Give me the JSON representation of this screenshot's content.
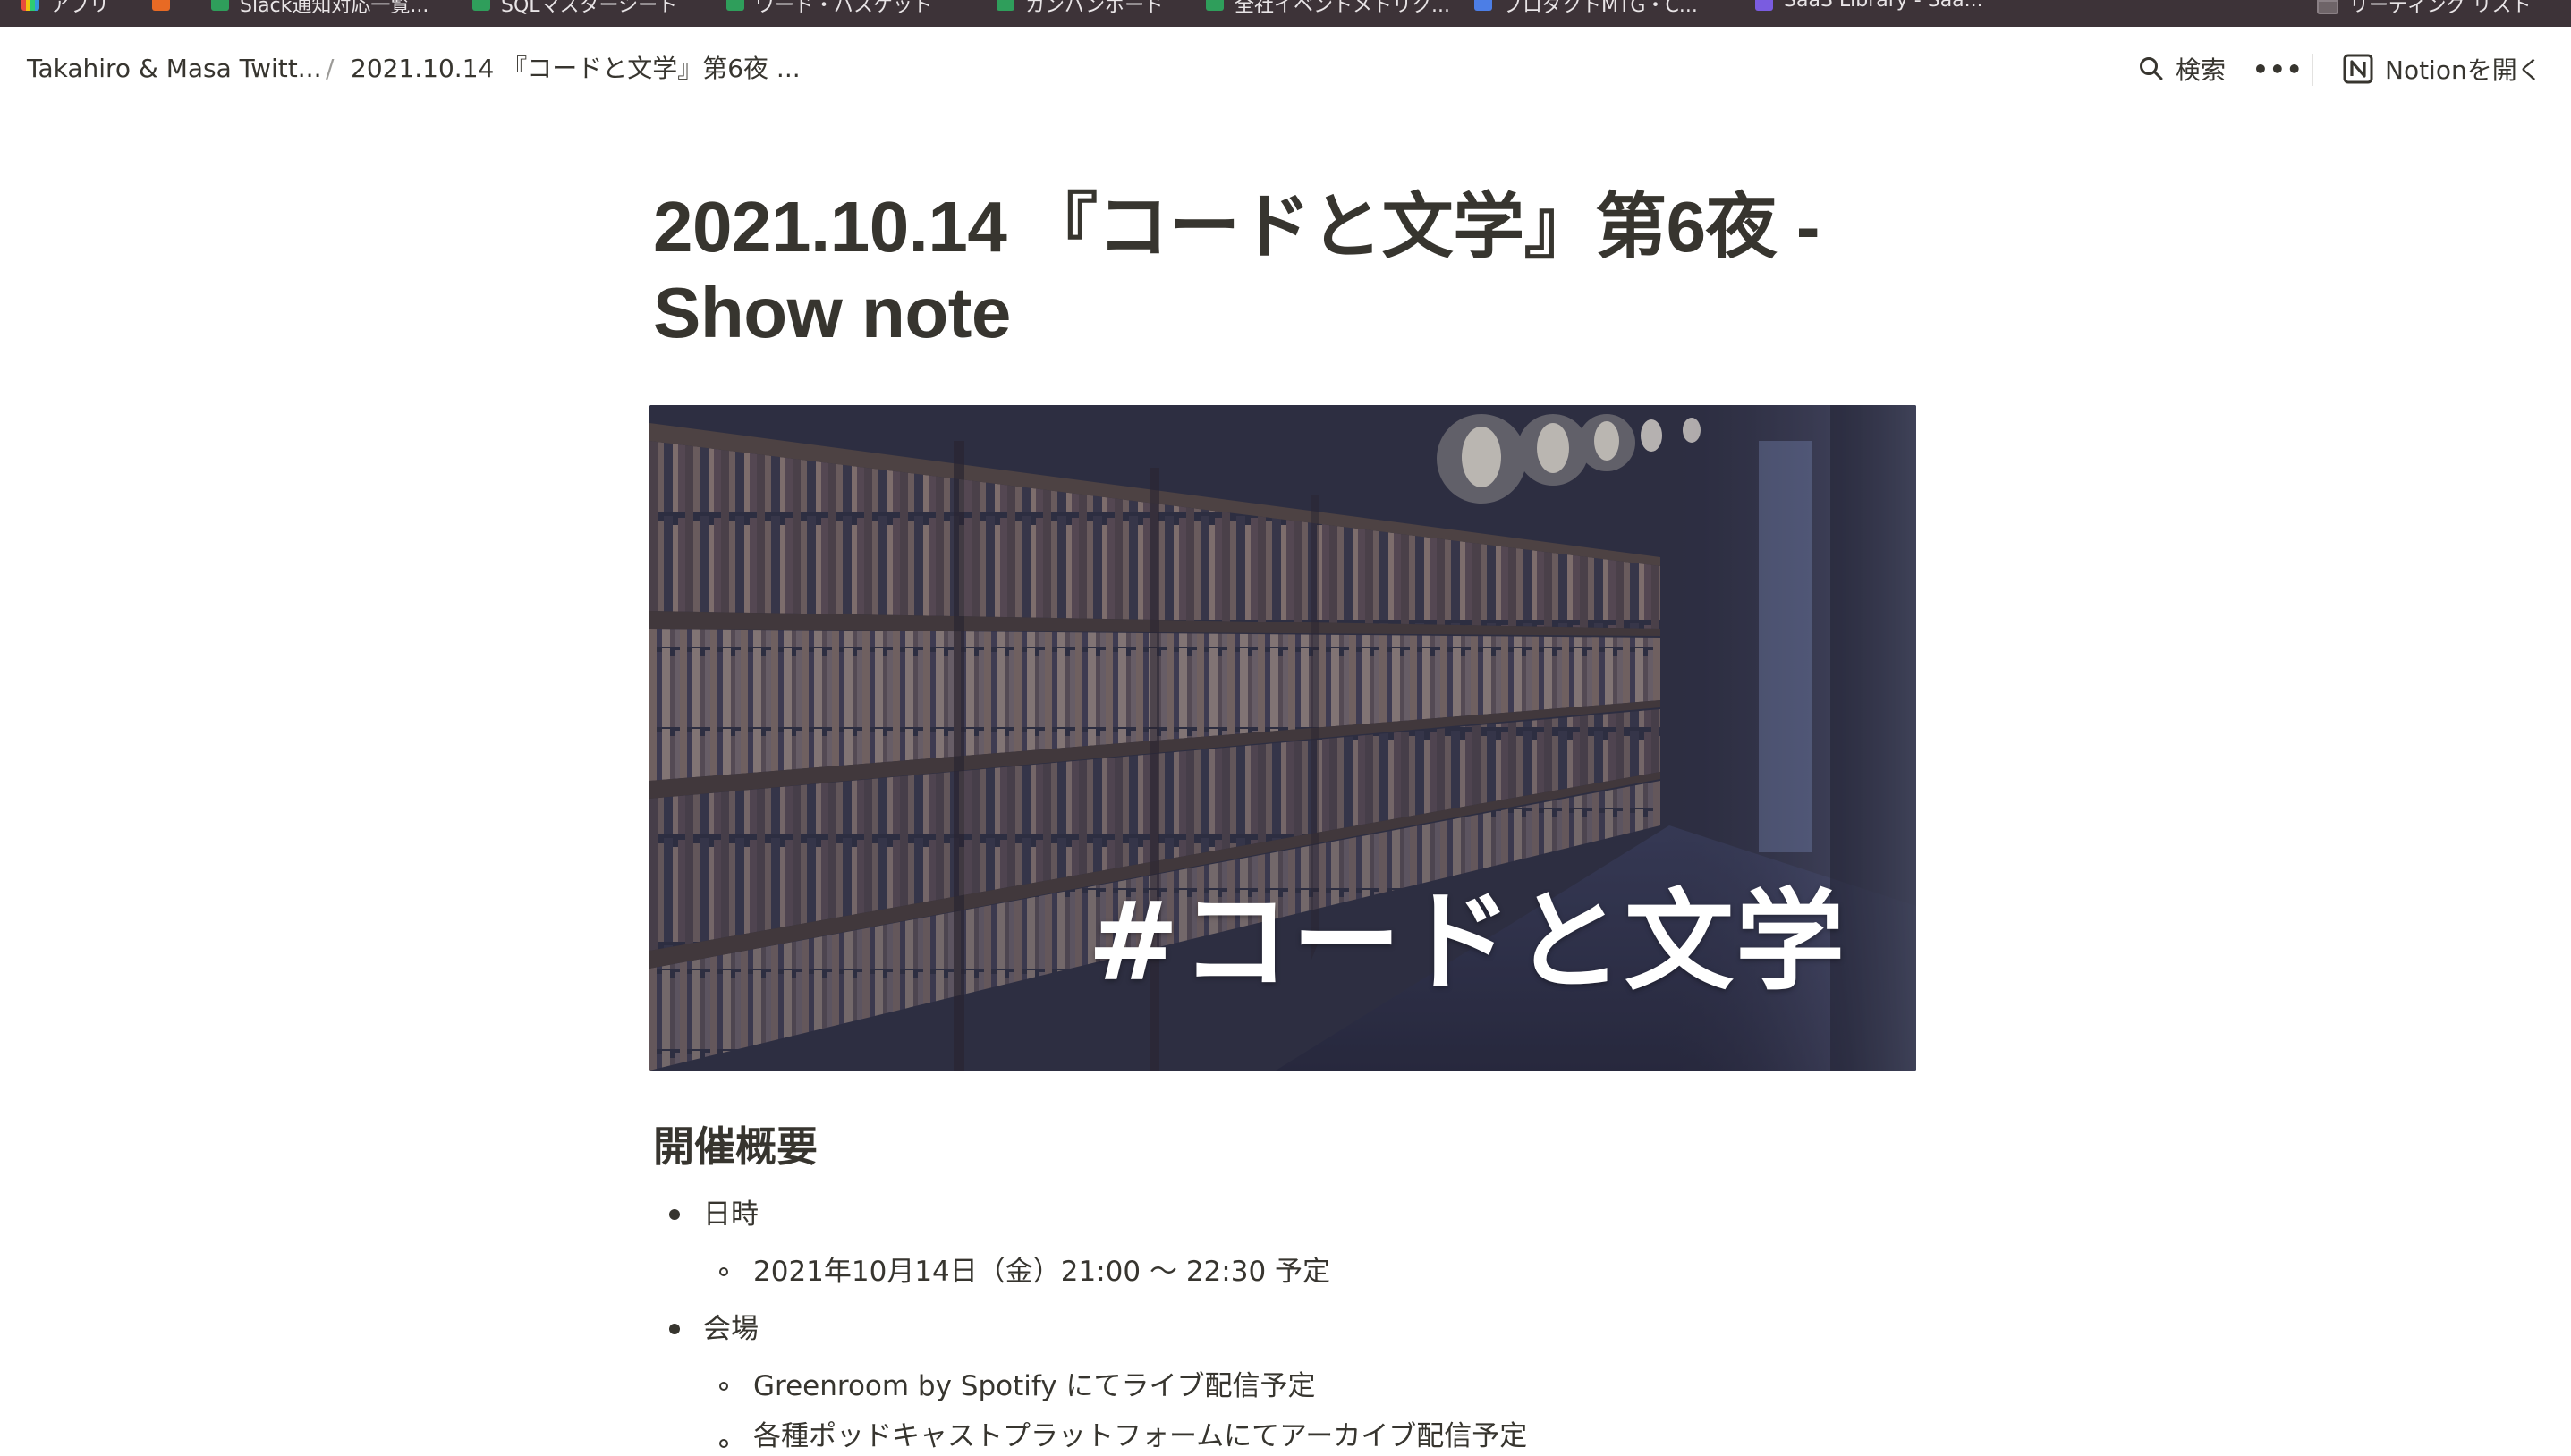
{
  "bookmarks": [
    {
      "label": "アプリ",
      "icon": "apps-grid-icon"
    },
    {
      "label": "",
      "icon": "orange-app-icon"
    },
    {
      "label": "Slack通知対応一覧...",
      "icon": "sheets-icon"
    },
    {
      "label": "SQLマスターシート",
      "icon": "sheets-icon"
    },
    {
      "label": "ワード・バスケット",
      "icon": "sheets-icon"
    },
    {
      "label": "カンバンボード",
      "icon": "sheets-icon"
    },
    {
      "label": "全社イベントメトリク...",
      "icon": "sheets-icon"
    },
    {
      "label": "プロダクトMTG・C...",
      "icon": "docs-icon"
    },
    {
      "label": "SaaS Library - Saa...",
      "icon": "saas-icon"
    },
    {
      "label": "リーディング リスト",
      "icon": "reading-list-icon"
    }
  ],
  "breadcrumb": {
    "parent": "Takahiro & Masa Twitt...",
    "separator": "/",
    "current": "2021.10.14 『コードと文学』第6夜 ..."
  },
  "actions": {
    "search_label": "検索",
    "more_label": "•••",
    "open_notion_label": "Notionを開く"
  },
  "page": {
    "title_line1": "2021.10.14 『コードと文学』第6夜 -",
    "title_line2": "Show note",
    "cover_text": "#コードと文学",
    "section_heading": "開催概要",
    "items": [
      {
        "label": "日時",
        "sub": "2021年10月14日（金）21:00 〜 22:30 予定"
      },
      {
        "label": "会場",
        "sub": "Greenroom by Spotify にてライブ配信予定",
        "sub2": "各種ポッドキャストプラットフォームにてアーカイブ配信予定"
      }
    ]
  }
}
